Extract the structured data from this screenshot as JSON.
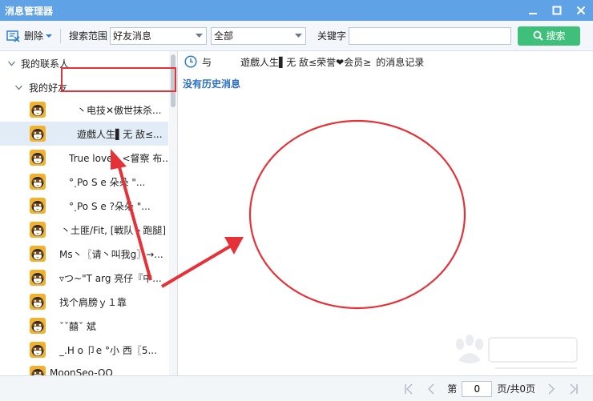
{
  "window": {
    "title": "消息管理器"
  },
  "toolbar": {
    "delete_label": "删除",
    "scope_label": "搜索范围",
    "scope_value": "好友消息",
    "scope2_value": "全部",
    "keyword_label": "关键字",
    "keyword_value": "",
    "search_label": "搜索"
  },
  "tree": {
    "root_label": "我的联系人",
    "group_label": "我的好友",
    "friends": [
      {
        "name": "丶电技✕傲世抹杀..."
      },
      {
        "name": "遊戲人生▌无 敌≤..."
      },
      {
        "name": "True love丶<督察 布..."
      },
      {
        "name": "°˰Po S e    朵朵 \"..."
      },
      {
        "name": "°˰Po S e    ?朵朵 \"..."
      },
      {
        "name": "丶土匪/Fit, [戦队丶跑腿]"
      },
      {
        "name": "Ms丶〖请丶叫我g〗→..."
      },
      {
        "name": "▿つ~\"T arg  亮仔『中..."
      },
      {
        "name": "找个肩膀ｙ１靠"
      },
      {
        "name": "ˇˇ囍ˇ 斌"
      },
      {
        "name": "_.H o 卩e °小  西〖5..."
      },
      {
        "name": "MoonSeo-QQ"
      }
    ]
  },
  "record": {
    "with_label": "与",
    "contact_name": "遊戲人生▌无 敌≤荣誉❤会员≥",
    "suffix": "的消息记录",
    "empty_message": "没有历史消息"
  },
  "pager": {
    "page_label": "第",
    "page_value": "0",
    "total_label": "页/共0页"
  },
  "colors": {
    "titlebar": "#5fa3e6",
    "search_button": "#3ec07b",
    "accent_red": "#e53238",
    "link_blue": "#2b6fc2"
  }
}
